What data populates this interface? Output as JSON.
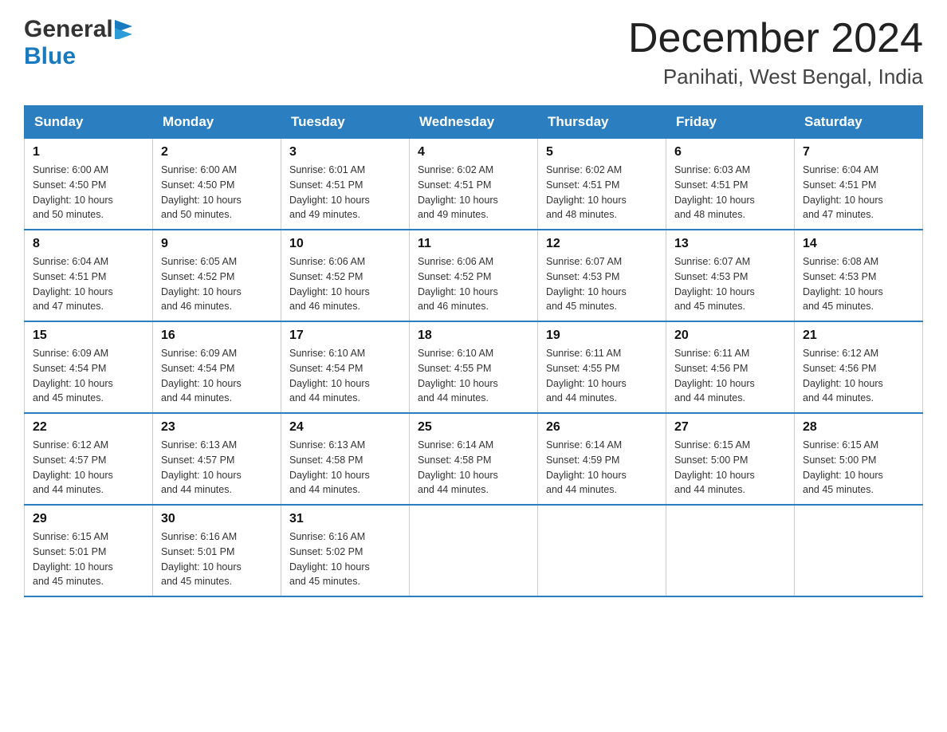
{
  "header": {
    "logo_general": "General",
    "logo_blue": "Blue",
    "month_title": "December 2024",
    "location": "Panihati, West Bengal, India"
  },
  "days_of_week": [
    "Sunday",
    "Monday",
    "Tuesday",
    "Wednesday",
    "Thursday",
    "Friday",
    "Saturday"
  ],
  "weeks": [
    [
      {
        "num": "1",
        "sunrise": "6:00 AM",
        "sunset": "4:50 PM",
        "daylight": "10 hours and 50 minutes."
      },
      {
        "num": "2",
        "sunrise": "6:00 AM",
        "sunset": "4:50 PM",
        "daylight": "10 hours and 50 minutes."
      },
      {
        "num": "3",
        "sunrise": "6:01 AM",
        "sunset": "4:51 PM",
        "daylight": "10 hours and 49 minutes."
      },
      {
        "num": "4",
        "sunrise": "6:02 AM",
        "sunset": "4:51 PM",
        "daylight": "10 hours and 49 minutes."
      },
      {
        "num": "5",
        "sunrise": "6:02 AM",
        "sunset": "4:51 PM",
        "daylight": "10 hours and 48 minutes."
      },
      {
        "num": "6",
        "sunrise": "6:03 AM",
        "sunset": "4:51 PM",
        "daylight": "10 hours and 48 minutes."
      },
      {
        "num": "7",
        "sunrise": "6:04 AM",
        "sunset": "4:51 PM",
        "daylight": "10 hours and 47 minutes."
      }
    ],
    [
      {
        "num": "8",
        "sunrise": "6:04 AM",
        "sunset": "4:51 PM",
        "daylight": "10 hours and 47 minutes."
      },
      {
        "num": "9",
        "sunrise": "6:05 AM",
        "sunset": "4:52 PM",
        "daylight": "10 hours and 46 minutes."
      },
      {
        "num": "10",
        "sunrise": "6:06 AM",
        "sunset": "4:52 PM",
        "daylight": "10 hours and 46 minutes."
      },
      {
        "num": "11",
        "sunrise": "6:06 AM",
        "sunset": "4:52 PM",
        "daylight": "10 hours and 46 minutes."
      },
      {
        "num": "12",
        "sunrise": "6:07 AM",
        "sunset": "4:53 PM",
        "daylight": "10 hours and 45 minutes."
      },
      {
        "num": "13",
        "sunrise": "6:07 AM",
        "sunset": "4:53 PM",
        "daylight": "10 hours and 45 minutes."
      },
      {
        "num": "14",
        "sunrise": "6:08 AM",
        "sunset": "4:53 PM",
        "daylight": "10 hours and 45 minutes."
      }
    ],
    [
      {
        "num": "15",
        "sunrise": "6:09 AM",
        "sunset": "4:54 PM",
        "daylight": "10 hours and 45 minutes."
      },
      {
        "num": "16",
        "sunrise": "6:09 AM",
        "sunset": "4:54 PM",
        "daylight": "10 hours and 44 minutes."
      },
      {
        "num": "17",
        "sunrise": "6:10 AM",
        "sunset": "4:54 PM",
        "daylight": "10 hours and 44 minutes."
      },
      {
        "num": "18",
        "sunrise": "6:10 AM",
        "sunset": "4:55 PM",
        "daylight": "10 hours and 44 minutes."
      },
      {
        "num": "19",
        "sunrise": "6:11 AM",
        "sunset": "4:55 PM",
        "daylight": "10 hours and 44 minutes."
      },
      {
        "num": "20",
        "sunrise": "6:11 AM",
        "sunset": "4:56 PM",
        "daylight": "10 hours and 44 minutes."
      },
      {
        "num": "21",
        "sunrise": "6:12 AM",
        "sunset": "4:56 PM",
        "daylight": "10 hours and 44 minutes."
      }
    ],
    [
      {
        "num": "22",
        "sunrise": "6:12 AM",
        "sunset": "4:57 PM",
        "daylight": "10 hours and 44 minutes."
      },
      {
        "num": "23",
        "sunrise": "6:13 AM",
        "sunset": "4:57 PM",
        "daylight": "10 hours and 44 minutes."
      },
      {
        "num": "24",
        "sunrise": "6:13 AM",
        "sunset": "4:58 PM",
        "daylight": "10 hours and 44 minutes."
      },
      {
        "num": "25",
        "sunrise": "6:14 AM",
        "sunset": "4:58 PM",
        "daylight": "10 hours and 44 minutes."
      },
      {
        "num": "26",
        "sunrise": "6:14 AM",
        "sunset": "4:59 PM",
        "daylight": "10 hours and 44 minutes."
      },
      {
        "num": "27",
        "sunrise": "6:15 AM",
        "sunset": "5:00 PM",
        "daylight": "10 hours and 44 minutes."
      },
      {
        "num": "28",
        "sunrise": "6:15 AM",
        "sunset": "5:00 PM",
        "daylight": "10 hours and 45 minutes."
      }
    ],
    [
      {
        "num": "29",
        "sunrise": "6:15 AM",
        "sunset": "5:01 PM",
        "daylight": "10 hours and 45 minutes."
      },
      {
        "num": "30",
        "sunrise": "6:16 AM",
        "sunset": "5:01 PM",
        "daylight": "10 hours and 45 minutes."
      },
      {
        "num": "31",
        "sunrise": "6:16 AM",
        "sunset": "5:02 PM",
        "daylight": "10 hours and 45 minutes."
      },
      null,
      null,
      null,
      null
    ]
  ],
  "labels": {
    "sunrise": "Sunrise:",
    "sunset": "Sunset:",
    "daylight": "Daylight:"
  }
}
